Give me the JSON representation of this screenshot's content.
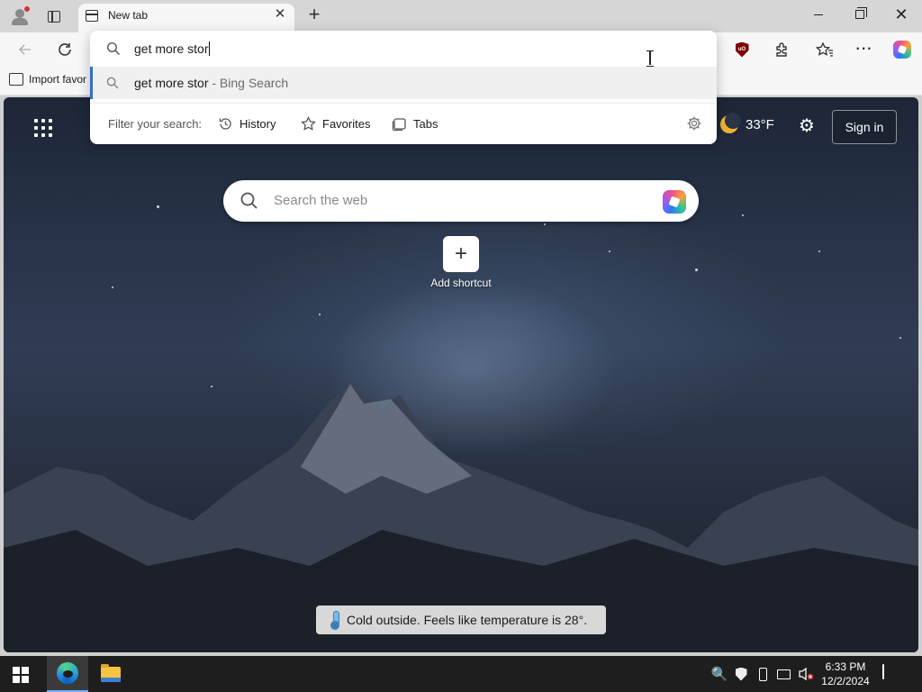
{
  "browser": {
    "tab": {
      "title": "New tab"
    },
    "favorites_bar": {
      "import_label": "Import favor"
    }
  },
  "omnibox": {
    "query": "get more stor",
    "suggestion": {
      "query": "get more stor",
      "source": " - Bing Search"
    },
    "filter_label": "Filter your search:",
    "filters": {
      "history": "History",
      "favorites": "Favorites",
      "tabs": "Tabs"
    }
  },
  "newtab": {
    "weather_temp": "33°F",
    "signin_label": "Sign in",
    "search_placeholder": "Search the web",
    "add_shortcut_label": "Add shortcut",
    "tip": "Cold outside. Feels like temperature is 28°."
  },
  "taskbar": {
    "time": "6:33 PM",
    "date": "12/2/2024"
  },
  "colors": {
    "accent": "#2f6fc9",
    "ublock": "#800000",
    "taskbar": "#1e1e1e"
  },
  "icons": [
    "profile-icon",
    "tab-actions-icon",
    "newtab-page-icon",
    "close-icon",
    "plus-icon",
    "back-icon",
    "refresh-icon",
    "ublock-icon",
    "extensions-icon",
    "favorites-icon",
    "more-icon",
    "copilot-icon",
    "search-icon",
    "history-icon",
    "star-icon",
    "tabs-icon",
    "gear-icon",
    "app-launcher-icon",
    "moon-icon",
    "thermometer-icon",
    "windows-start-icon",
    "edge-icon",
    "file-explorer-icon",
    "defender-icon",
    "battery-icon",
    "network-icon",
    "volume-muted-icon",
    "notifications-icon"
  ]
}
